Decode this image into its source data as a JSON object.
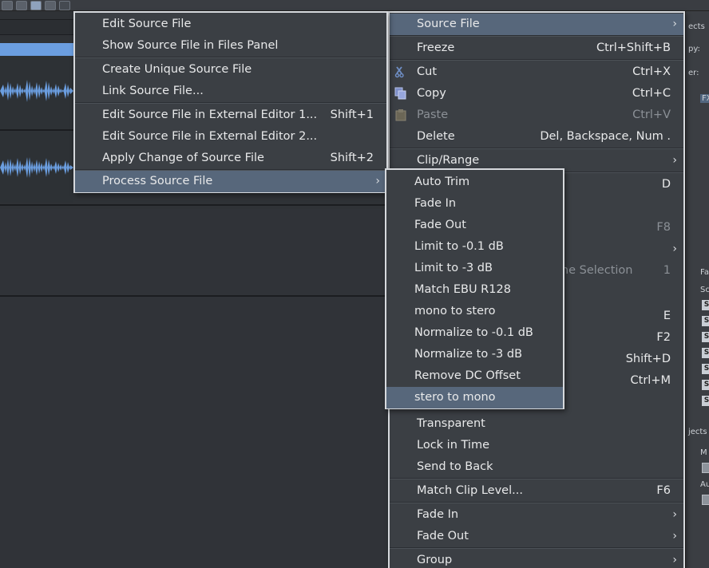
{
  "main_menu": {
    "items": [
      {
        "label": "Source File",
        "shortcut": "",
        "submenu": true,
        "highlighted": true
      },
      {
        "label": "Freeze",
        "shortcut": "Ctrl+Shift+B"
      },
      {
        "label": "Cut",
        "shortcut": "Ctrl+X",
        "icon": "scissors-icon"
      },
      {
        "label": "Copy",
        "shortcut": "Ctrl+C",
        "icon": "copy-icon"
      },
      {
        "label": "Paste",
        "shortcut": "Ctrl+V",
        "icon": "paste-icon",
        "disabled": true
      },
      {
        "label": "Delete",
        "shortcut": "Del, Backspace, Num ."
      },
      {
        "label": "Clip/Range",
        "shortcut": "",
        "submenu": true
      },
      {
        "label": "",
        "shortcut": "D"
      },
      {
        "label": "",
        "shortcut": "F8",
        "disabled": true
      },
      {
        "label": "",
        "shortcut": "",
        "submenu": true
      },
      {
        "label": "me Selection",
        "shortcut": "1",
        "disabled": true
      },
      {
        "label": "",
        "shortcut": "E"
      },
      {
        "label": "",
        "shortcut": "F2"
      },
      {
        "label": "",
        "shortcut": "Shift+D"
      },
      {
        "label": "",
        "shortcut": "Ctrl+M"
      },
      {
        "label": "Transparent",
        "shortcut": ""
      },
      {
        "label": "Lock in Time",
        "shortcut": ""
      },
      {
        "label": "Send to Back",
        "shortcut": ""
      },
      {
        "label": "Match Clip Level...",
        "shortcut": "F6"
      },
      {
        "label": "Fade In",
        "shortcut": "",
        "submenu": true
      },
      {
        "label": "Fade Out",
        "shortcut": "",
        "submenu": true
      },
      {
        "label": "Group",
        "shortcut": "",
        "submenu": true
      }
    ]
  },
  "source_menu": {
    "items": [
      {
        "label": "Edit Source File",
        "shortcut": ""
      },
      {
        "label": "Show Source File in Files Panel",
        "shortcut": ""
      },
      {
        "label": "Create Unique Source File",
        "shortcut": ""
      },
      {
        "label": "Link Source File...",
        "shortcut": ""
      },
      {
        "label": "Edit Source File in External Editor 1...",
        "shortcut": "Shift+1"
      },
      {
        "label": "Edit Source File in External Editor 2...",
        "shortcut": ""
      },
      {
        "label": "Apply Change of Source File",
        "shortcut": "Shift+2"
      },
      {
        "label": "Process Source File",
        "shortcut": "",
        "submenu": true,
        "highlighted": true
      }
    ]
  },
  "process_menu": {
    "items": [
      {
        "label": "Auto Trim"
      },
      {
        "label": "Fade In"
      },
      {
        "label": "Fade Out"
      },
      {
        "label": "Limit to -0.1 dB"
      },
      {
        "label": "Limit to -3 dB"
      },
      {
        "label": "Match EBU R128"
      },
      {
        "label": "mono to stero"
      },
      {
        "label": "Normalize to -0.1 dB"
      },
      {
        "label": "Normalize to -3 dB"
      },
      {
        "label": "Remove DC Offset"
      },
      {
        "label": "stero to mono",
        "highlighted": true
      }
    ]
  },
  "right_panel": {
    "labels": [
      "ects",
      "py:",
      "er:",
      "FX",
      "Fa",
      "Sc",
      "jects",
      "M",
      "Au"
    ]
  },
  "colors": {
    "menu_bg": "#3b3f44",
    "menu_border": "#d6d9dd",
    "highlight": "#57677b",
    "waveform": "#6b9ee0",
    "disabled_text": "#8b9096"
  }
}
